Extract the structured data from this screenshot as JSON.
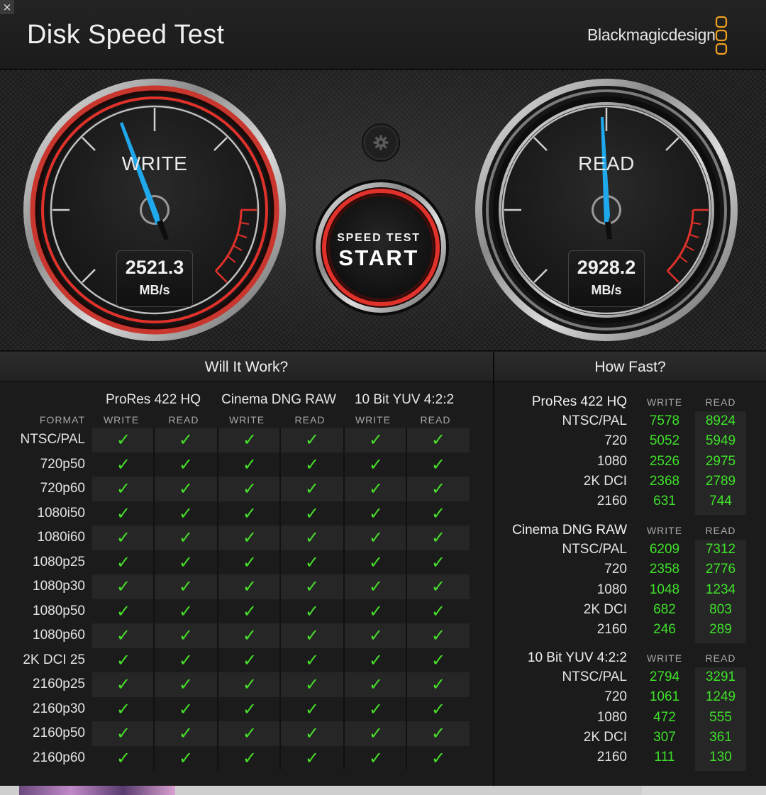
{
  "window": {
    "close_glyph": "×",
    "title": "Disk Speed Test",
    "brand": "Blackmagicdesign"
  },
  "gauges": {
    "write": {
      "label": "WRITE",
      "value": "2521.3",
      "unit": "MB/s"
    },
    "read": {
      "label": "READ",
      "value": "2928.2",
      "unit": "MB/s"
    },
    "settings_icon": "gear-icon",
    "start_button": {
      "small": "SPEED TEST",
      "big": "START"
    }
  },
  "will_it_work": {
    "title": "Will It Work?",
    "format_header": "FORMAT",
    "groups": [
      {
        "name": "ProRes 422 HQ",
        "write": "WRITE",
        "read": "READ"
      },
      {
        "name": "Cinema DNG RAW",
        "write": "WRITE",
        "read": "READ"
      },
      {
        "name": "10 Bit YUV 4:2:2",
        "write": "WRITE",
        "read": "READ"
      }
    ],
    "check_glyph": "✓",
    "rows": [
      "NTSC/PAL",
      "720p50",
      "720p60",
      "1080i50",
      "1080i60",
      "1080p25",
      "1080p30",
      "1080p50",
      "1080p60",
      "2K DCI 25",
      "2160p25",
      "2160p30",
      "2160p50",
      "2160p60"
    ]
  },
  "how_fast": {
    "title": "How Fast?",
    "write_header": "WRITE",
    "read_header": "READ",
    "sections": [
      {
        "name": "ProRes 422 HQ",
        "rows": [
          {
            "label": "NTSC/PAL",
            "write": "7578",
            "read": "8924"
          },
          {
            "label": "720",
            "write": "5052",
            "read": "5949"
          },
          {
            "label": "1080",
            "write": "2526",
            "read": "2975"
          },
          {
            "label": "2K DCI",
            "write": "2368",
            "read": "2789"
          },
          {
            "label": "2160",
            "write": "631",
            "read": "744"
          }
        ]
      },
      {
        "name": "Cinema DNG RAW",
        "rows": [
          {
            "label": "NTSC/PAL",
            "write": "6209",
            "read": "7312"
          },
          {
            "label": "720",
            "write": "2358",
            "read": "2776"
          },
          {
            "label": "1080",
            "write": "1048",
            "read": "1234"
          },
          {
            "label": "2K DCI",
            "write": "682",
            "read": "803"
          },
          {
            "label": "2160",
            "write": "246",
            "read": "289"
          }
        ]
      },
      {
        "name": "10 Bit YUV 4:2:2",
        "rows": [
          {
            "label": "NTSC/PAL",
            "write": "2794",
            "read": "3291"
          },
          {
            "label": "720",
            "write": "1061",
            "read": "1249"
          },
          {
            "label": "1080",
            "write": "472",
            "read": "555"
          },
          {
            "label": "2K DCI",
            "write": "307",
            "read": "361"
          },
          {
            "label": "2160",
            "write": "111",
            "read": "130"
          }
        ]
      }
    ]
  },
  "colors": {
    "check_green": "#47e02a",
    "value_green": "#3fe12a",
    "needle_blue": "#1fa8ec",
    "gauge_red": "#e0312a",
    "brand_orange": "#f0a020"
  }
}
